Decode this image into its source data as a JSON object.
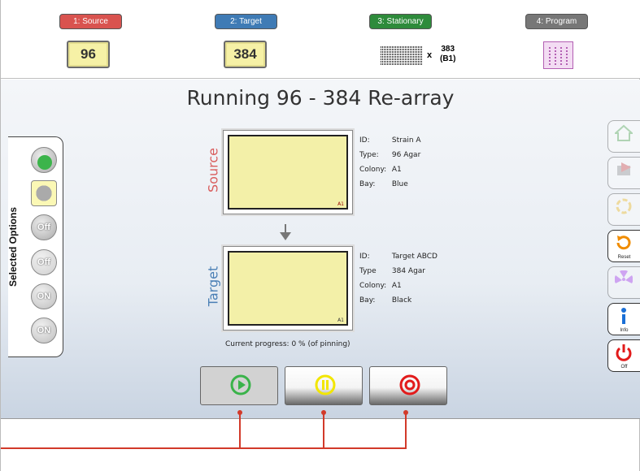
{
  "steps": [
    {
      "label": "1: Source",
      "color": "#d9534f"
    },
    {
      "label": "2: Target",
      "color": "#3f7bb5"
    },
    {
      "label": "3: Stationary",
      "color": "#2e8b3b"
    },
    {
      "label": "4: Program",
      "color": "#777777"
    }
  ],
  "header": {
    "source_plate": "96",
    "target_plate": "384",
    "stationary_x": "x",
    "stationary_count": "383",
    "stationary_bay": "(B1)"
  },
  "main": {
    "title": "Running 96 - 384 Re-array",
    "options_label": "Selected Options",
    "options": [
      {
        "icon": "recycle-icon",
        "text": ""
      },
      {
        "icon": "reset-icon",
        "text": ""
      },
      {
        "icon": "off-wash-icon",
        "text": "Off"
      },
      {
        "icon": "off-icon",
        "text": "Off"
      },
      {
        "icon": "pin-on-icon",
        "text": "ON"
      },
      {
        "icon": "pin-on-icon-2",
        "text": "ON"
      }
    ],
    "source": {
      "side_label": "Source",
      "side_color": "#d95c5c",
      "mark": "A1",
      "rows": [
        {
          "key": "ID:",
          "value": "Strain A"
        },
        {
          "key": "Type:",
          "value": "96 Agar"
        },
        {
          "key": "Colony:",
          "value": "A1"
        },
        {
          "key": "Bay:",
          "value": "Blue"
        }
      ]
    },
    "target": {
      "side_label": "Target",
      "side_color": "#4a7fb5",
      "mark": "A1",
      "rows": [
        {
          "key": "ID:",
          "value": "Target ABCD"
        },
        {
          "key": "Type",
          "value": "384 Agar"
        },
        {
          "key": "Colony:",
          "value": "A1"
        },
        {
          "key": "Bay:",
          "value": "Black"
        }
      ]
    },
    "progress": {
      "prefix": "Current progress:",
      "value": "0",
      "suffix": "% (of pinning)"
    }
  },
  "toolbar": [
    {
      "icon": "home-icon",
      "label": "",
      "enabled": false
    },
    {
      "icon": "back-icon",
      "label": "",
      "enabled": false
    },
    {
      "icon": "settings-icon",
      "label": "",
      "enabled": false
    },
    {
      "icon": "reset-icon",
      "label": "Reset",
      "enabled": true
    },
    {
      "icon": "hazard-icon",
      "label": "",
      "enabled": false
    },
    {
      "icon": "info-icon",
      "label": "Info",
      "enabled": true
    },
    {
      "icon": "power-icon",
      "label": "Off",
      "enabled": true
    }
  ],
  "controls": [
    {
      "icon": "play-icon",
      "color": "#3ab34a",
      "active": true
    },
    {
      "icon": "pause-icon",
      "color": "#f2e600",
      "active": false
    },
    {
      "icon": "stop-icon",
      "color": "#e21b1b",
      "active": false
    }
  ]
}
